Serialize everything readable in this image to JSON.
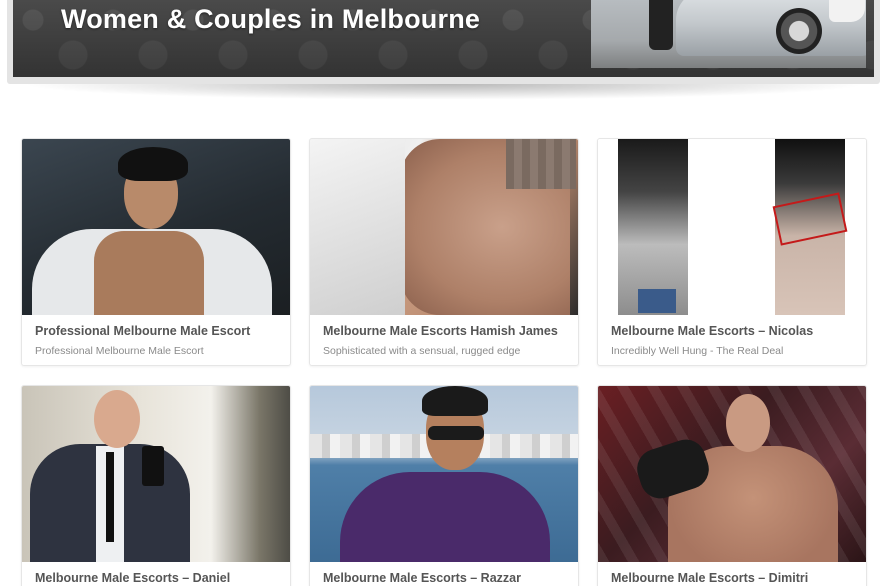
{
  "banner": {
    "title": "Women & Couples in Melbourne"
  },
  "listings": [
    {
      "title": "Professional Melbourne Male Escort",
      "subtitle": "Professional Melbourne Male Escort"
    },
    {
      "title": "Melbourne Male Escorts Hamish James",
      "subtitle": "Sophisticated with a sensual, rugged edge"
    },
    {
      "title": "Melbourne Male Escorts – Nicolas",
      "subtitle": "Incredibly Well Hung - The Real Deal"
    },
    {
      "title": "Melbourne Male Escorts – Daniel",
      "subtitle": ""
    },
    {
      "title": "Melbourne Male Escorts – Razzar",
      "subtitle": ""
    },
    {
      "title": "Melbourne Male Escorts – Dimitri",
      "subtitle": ""
    }
  ]
}
